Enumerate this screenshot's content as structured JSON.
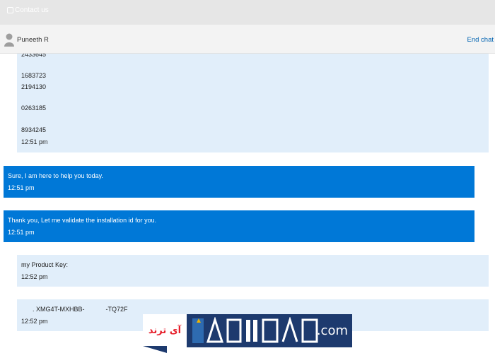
{
  "title_bar": {
    "label": "Contact us",
    "icon": "phone-icon"
  },
  "chat_header": {
    "avatar_icon": "person-icon",
    "agent_name": "Puneeth R",
    "end_chat_label": "End chat"
  },
  "messages": [
    {
      "sender": "user",
      "lines": [
        "2433645",
        "",
        "1683723",
        "2194130",
        "",
        "0263185",
        "",
        "8934245"
      ],
      "time": "12:51 pm"
    },
    {
      "sender": "agent",
      "lines": [
        "Sure, I am here to help you today."
      ],
      "time": "12:51 pm"
    },
    {
      "sender": "agent",
      "lines": [
        "Thank you, Let me validate the installation id for you."
      ],
      "time": "12:51 pm"
    },
    {
      "sender": "user",
      "lines": [
        "my Product Key:"
      ],
      "time": "12:52 pm"
    },
    {
      "sender": "user",
      "lines": [
        ". XMG4T-MXHBB-            -TQ72F"
      ],
      "time": "12:52 pm"
    }
  ],
  "watermark": {
    "left_text": "آی ترند",
    "right_text": ".com"
  },
  "colors": {
    "title_bar_bg": "#e6e6e6",
    "header_bg": "#f3f3f3",
    "user_bubble": "#e1eefa",
    "agent_bubble": "#0078d7",
    "link": "#0063b1"
  }
}
